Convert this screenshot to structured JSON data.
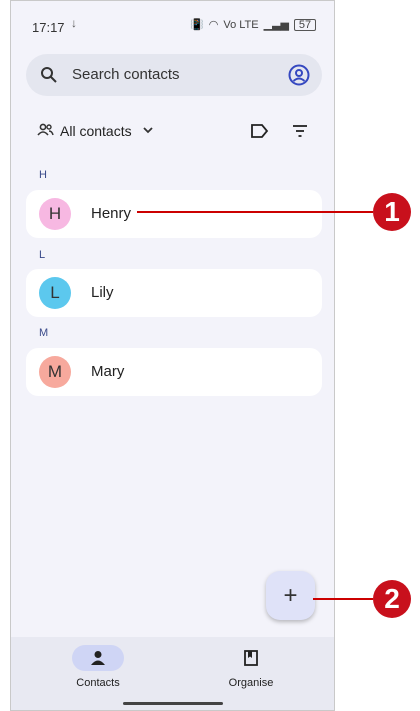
{
  "status_bar": {
    "time": "17:17",
    "download": "↓",
    "lte": "Vo LTE",
    "battery": "57"
  },
  "search": {
    "placeholder": "Search contacts"
  },
  "filter": {
    "label": "All contacts"
  },
  "contacts": [
    {
      "section": "H",
      "initial": "H",
      "name": "Henry",
      "color": "#f7b8e2"
    },
    {
      "section": "L",
      "initial": "L",
      "name": "Lily",
      "color": "#5cc8ee"
    },
    {
      "section": "M",
      "initial": "M",
      "name": "Mary",
      "color": "#f7a99d"
    }
  ],
  "fab": {
    "label": "+"
  },
  "nav": {
    "contacts": "Contacts",
    "organise": "Organise"
  },
  "callouts": [
    "1",
    "2"
  ]
}
